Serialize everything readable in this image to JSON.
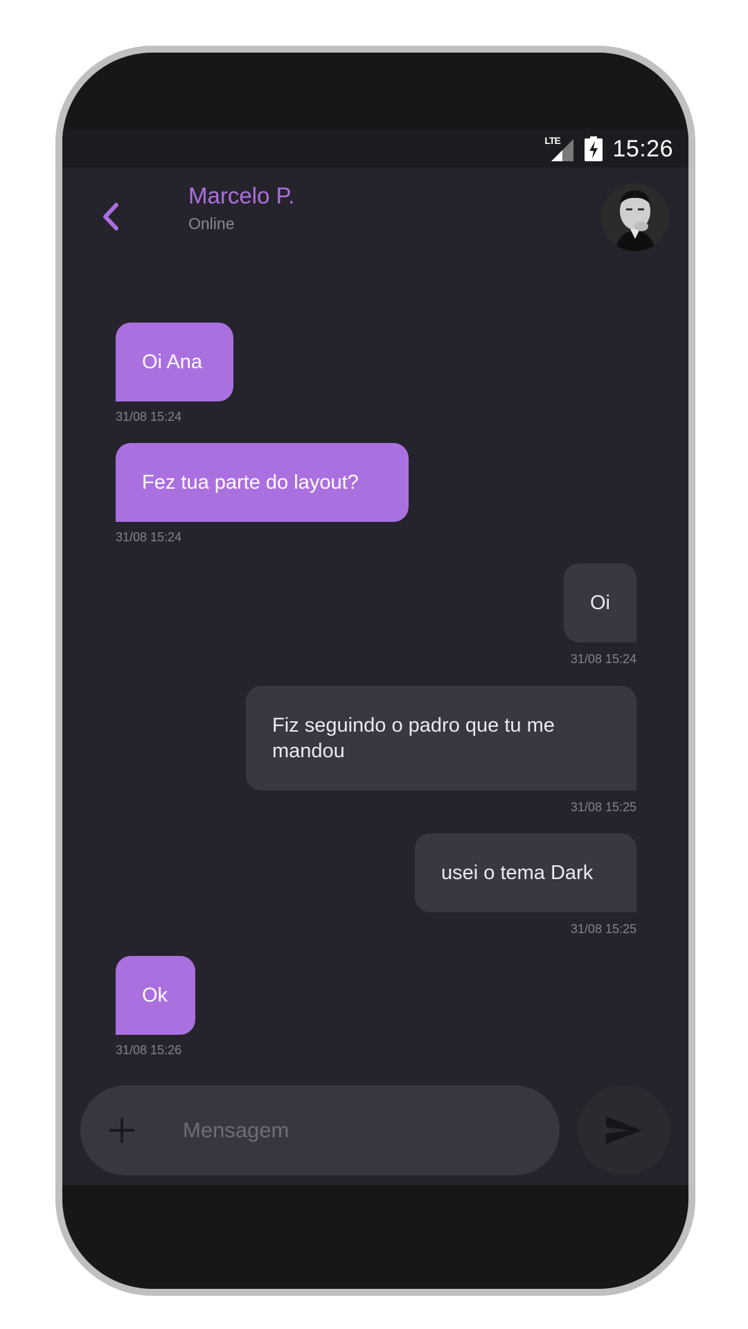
{
  "status_bar": {
    "network": "LTE",
    "time": "15:26"
  },
  "header": {
    "contact_name": "Marcelo P.",
    "contact_status": "Online"
  },
  "messages": [
    {
      "direction": "in",
      "text": "Oi Ana",
      "timestamp": "31/08 15:24"
    },
    {
      "direction": "in",
      "text": "Fez tua parte do layout?",
      "timestamp": "31/08 15:24"
    },
    {
      "direction": "out",
      "text": "Oi",
      "timestamp": "31/08 15:24"
    },
    {
      "direction": "out",
      "text": "Fiz seguindo o padro que tu me mandou",
      "timestamp": "31/08 15:25"
    },
    {
      "direction": "out",
      "text": "usei o tema Dark",
      "timestamp": "31/08 15:25"
    },
    {
      "direction": "in",
      "text": "Ok",
      "timestamp": "31/08 15:26"
    }
  ],
  "composer": {
    "placeholder": "Mensagem",
    "value": ""
  },
  "icons": {
    "back": "chevron-left-icon",
    "add": "plus-icon",
    "send": "send-icon",
    "signal": "lte-signal-icon",
    "battery": "battery-charging-icon"
  },
  "colors": {
    "accent": "#ab70e0",
    "background": "#25232b",
    "outgoing_bubble": "#3a3743",
    "input_background": "#393641"
  }
}
